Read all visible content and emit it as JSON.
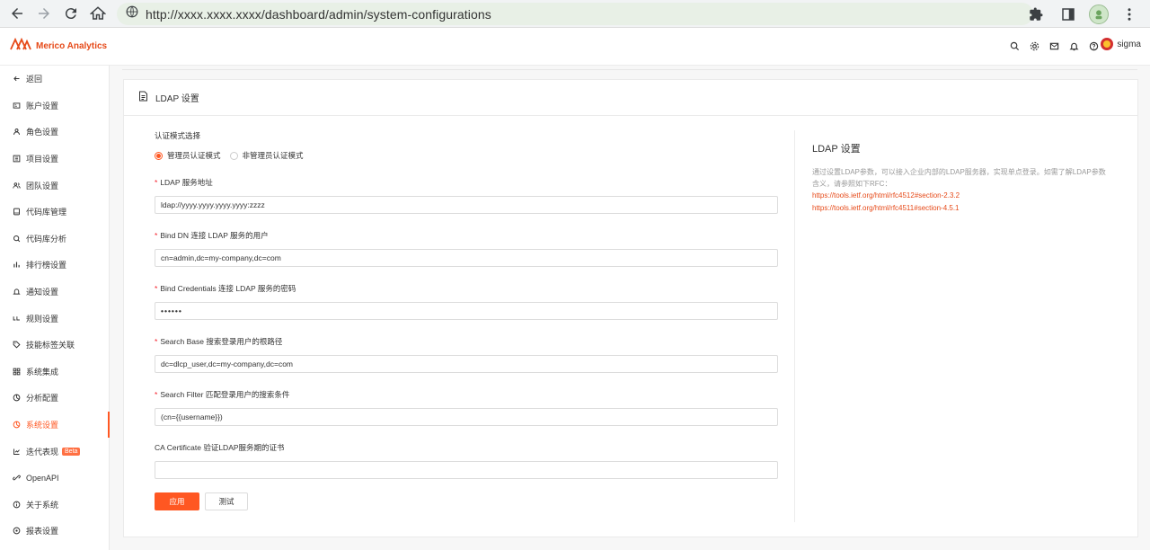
{
  "browser": {
    "url": "http://xxxx.xxxx.xxxx/dashboard/admin/system-configurations"
  },
  "header": {
    "brand": "Merico Analytics",
    "user_name": "sigma"
  },
  "sidebar": {
    "items": [
      {
        "label": "返回",
        "icon": "arrow-left-icon"
      },
      {
        "label": "账户设置",
        "icon": "account-icon"
      },
      {
        "label": "角色设置",
        "icon": "role-icon"
      },
      {
        "label": "项目设置",
        "icon": "project-icon"
      },
      {
        "label": "团队设置",
        "icon": "team-icon"
      },
      {
        "label": "代码库管理",
        "icon": "repo-icon"
      },
      {
        "label": "代码库分析",
        "icon": "analysis-icon"
      },
      {
        "label": "排行榜设置",
        "icon": "ranking-icon"
      },
      {
        "label": "通知设置",
        "icon": "bell-icon"
      },
      {
        "label": "规则设置",
        "icon": "rules-icon"
      },
      {
        "label": "技能标签关联",
        "icon": "tag-icon"
      },
      {
        "label": "系统集成",
        "icon": "integration-icon"
      },
      {
        "label": "分析配置",
        "icon": "config-icon"
      },
      {
        "label": "系统设置",
        "icon": "system-icon",
        "active": true
      },
      {
        "label": "迭代表现",
        "icon": "iteration-icon",
        "badge": "Beta"
      },
      {
        "label": "OpenAPI",
        "icon": "api-icon"
      },
      {
        "label": "关于系统",
        "icon": "info-icon"
      },
      {
        "label": "报表设置",
        "icon": "report-icon"
      }
    ]
  },
  "card": {
    "title": "LDAP 设置"
  },
  "form": {
    "mode_label": "认证模式选择",
    "mode_options": [
      "管理员认证模式",
      "非管理员认证模式"
    ],
    "mode_selected": 0,
    "fields": [
      {
        "label": "LDAP 服务地址",
        "value": "ldap://yyyy.yyyy.yyyy.yyyy:zzzz",
        "required": true
      },
      {
        "label": "Bind DN 连接 LDAP 服务的用户",
        "value": "cn=admin,dc=my-company,dc=com",
        "required": true
      },
      {
        "label": "Bind Credentials 连接 LDAP 服务的密码",
        "value": "••••••",
        "required": true
      },
      {
        "label": "Search Base 搜索登录用户的根路径",
        "value": "dc=dlcp_user,dc=my-company,dc=com",
        "required": true
      },
      {
        "label": "Search Filter 匹配登录用户的搜索条件",
        "value": "(cn={{username}})",
        "required": true
      },
      {
        "label": "CA Certificate 验证LDAP服务期的证书",
        "value": "",
        "required": false
      }
    ],
    "apply_label": "应用",
    "test_label": "测试"
  },
  "help": {
    "title": "LDAP 设置",
    "text": "通过设置LDAP参数，可以接入企业内部的LDAP服务器，实现单点登录。如需了解LDAP参数含义，请参照如下RFC：",
    "links": [
      "https://tools.ietf.org/html/rfc4512#section-2.3.2",
      "https://tools.ietf.org/html/rfc4511#section-4.5.1"
    ]
  },
  "colors": {
    "accent": "#ff5722",
    "brand": "#e64a19"
  }
}
